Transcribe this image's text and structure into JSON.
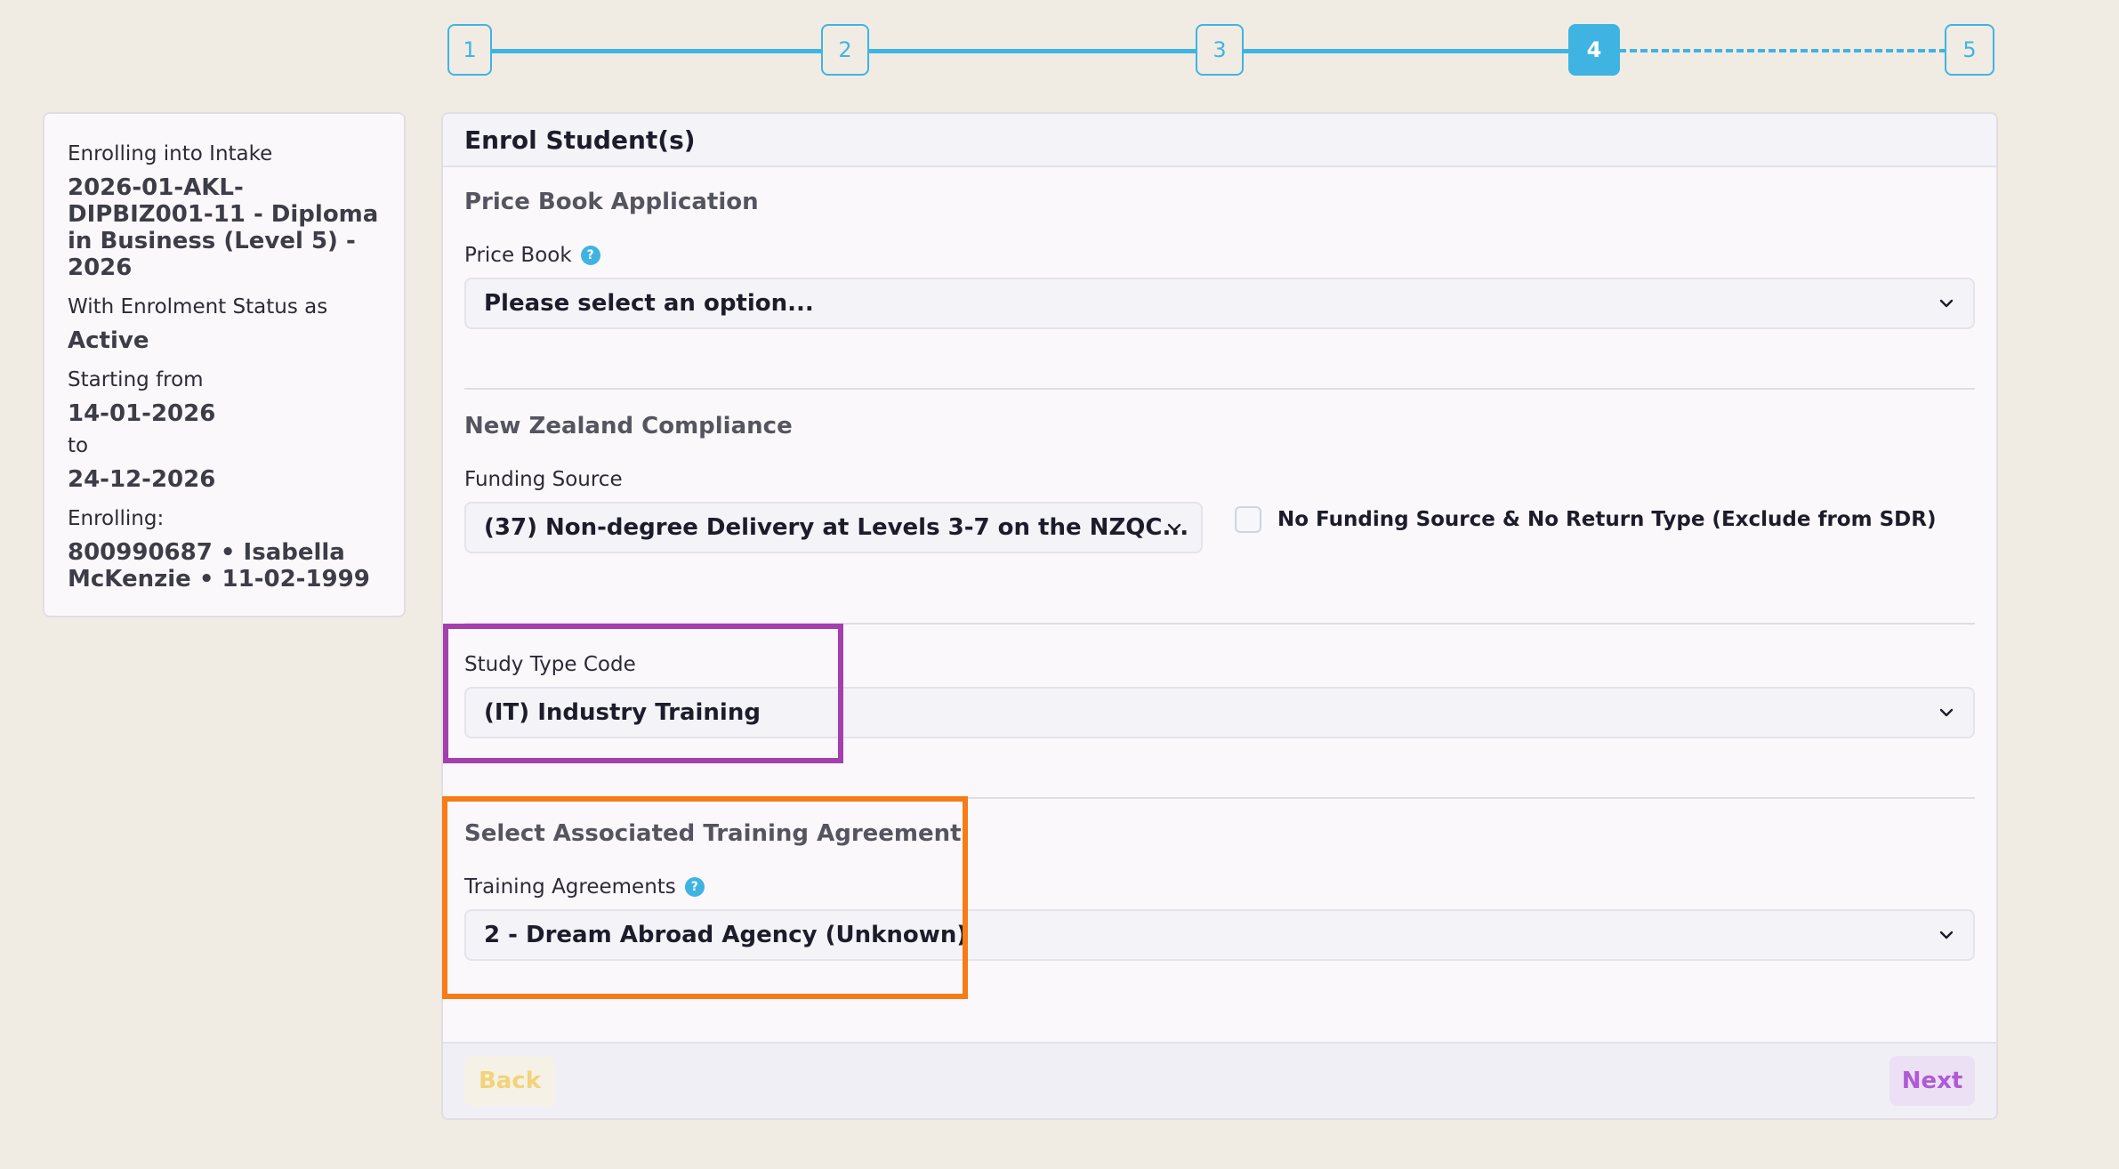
{
  "stepper": {
    "steps": [
      "1",
      "2",
      "3",
      "4",
      "5"
    ],
    "active": "4"
  },
  "summary": {
    "intake_label": "Enrolling into Intake",
    "intake_value": "2026-01-AKL-DIPBIZ001-11 - Diploma in Business (Level 5) - 2026",
    "status_label": "With Enrolment Status as",
    "status_value": "Active",
    "start_label": "Starting from",
    "start_value": "14-01-2026",
    "to_label": "to",
    "end_value": "24-12-2026",
    "enrolling_label": "Enrolling:",
    "enrolling_value": "800990687 • Isabella McKenzie • 11-02-1999"
  },
  "panel": {
    "title": "Enrol Student(s)",
    "price_book_section": "Price Book Application",
    "price_book_label": "Price Book",
    "price_book_value": "Please select an option...",
    "nz_section": "New Zealand Compliance",
    "funding_label": "Funding Source",
    "funding_value": "(37) Non-degree Delivery at Levels 3-7 on the NZQC...",
    "no_funding_label": "No Funding Source & No Return Type (Exclude from SDR)",
    "study_type_label": "Study Type Code",
    "study_type_value": "(IT) Industry Training",
    "ta_section": "Select Associated Training Agreement",
    "ta_label": "Training Agreements",
    "ta_value": "2 - Dream Abroad Agency (Unknown)",
    "back_label": "Back",
    "next_label": "Next"
  },
  "icons": {
    "help": "question-mark",
    "select": "chevron-down"
  },
  "colors": {
    "accent": "#3fb4e2",
    "highlight_purple": "#a43fae",
    "highlight_orange": "#f77b16"
  }
}
